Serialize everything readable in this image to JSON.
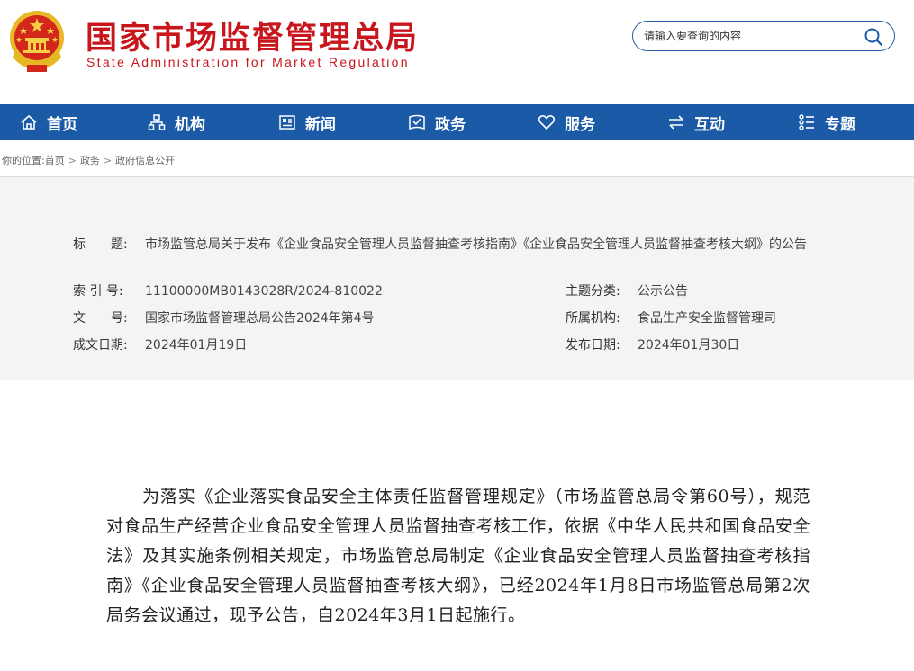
{
  "header": {
    "title": "国家市场监督管理总局",
    "subtitle": "State Administration for Market Regulation",
    "emblem_icon": "national-emblem-icon",
    "brand_color": "#c8161d"
  },
  "search": {
    "placeholder": "请输入要查询的内容",
    "icon": "search-icon"
  },
  "nav": {
    "color": "#1a5aa6",
    "items": [
      {
        "label": "首页",
        "icon": "home-icon"
      },
      {
        "label": "机构",
        "icon": "org-chart-icon"
      },
      {
        "label": "新闻",
        "icon": "news-icon"
      },
      {
        "label": "政务",
        "icon": "government-affairs-icon"
      },
      {
        "label": "服务",
        "icon": "heart-icon"
      },
      {
        "label": "互动",
        "icon": "exchange-arrows-icon"
      },
      {
        "label": "专题",
        "icon": "topic-list-icon"
      }
    ]
  },
  "breadcrumb": {
    "prefix": "你的位置:",
    "items": [
      "首页",
      "政务",
      "政府信息公开"
    ],
    "separator": ">"
  },
  "info": {
    "title_label": "标　　题:",
    "title_value": "市场监管总局关于发布《企业食品安全管理人员监督抽查考核指南》《企业食品安全管理人员监督抽查考核大纲》的公告",
    "index_label": "索 引 号:",
    "index_value": "11100000MB0143028R/2024-810022",
    "category_label": "主题分类:",
    "category_value": "公示公告",
    "docno_label": "文　　号:",
    "docno_value": "国家市场监督管理总局公告2024年第4号",
    "agency_label": "所属机构:",
    "agency_value": "食品生产安全监督管理司",
    "created_label": "成文日期:",
    "created_value": "2024年01月19日",
    "published_label": "发布日期:",
    "published_value": "2024年01月30日"
  },
  "article": {
    "paragraph": "为落实《企业落实食品安全主体责任监督管理规定》（市场监管总局令第60号），规范对食品生产经营企业食品安全管理人员监督抽查考核工作，依据《中华人民共和国食品安全法》及其实施条例相关规定，市场监管总局制定《企业食品安全管理人员监督抽查考核指南》《企业食品安全管理人员监督抽查考核大纲》，已经2024年1月8日市场监管总局第2次局务会议通过，现予公告，自2024年3月1日起施行。"
  }
}
